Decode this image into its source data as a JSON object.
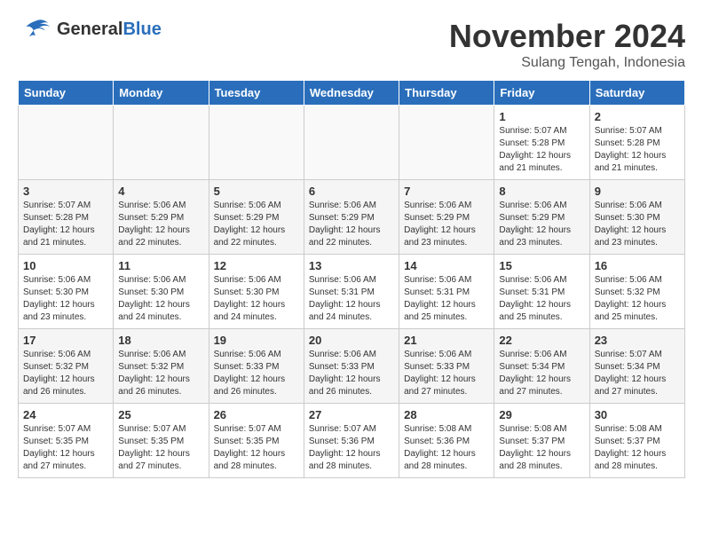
{
  "header": {
    "logo_general": "General",
    "logo_blue": "Blue",
    "month_title": "November 2024",
    "subtitle": "Sulang Tengah, Indonesia"
  },
  "weekdays": [
    "Sunday",
    "Monday",
    "Tuesday",
    "Wednesday",
    "Thursday",
    "Friday",
    "Saturday"
  ],
  "weeks": [
    [
      {
        "day": "",
        "info": ""
      },
      {
        "day": "",
        "info": ""
      },
      {
        "day": "",
        "info": ""
      },
      {
        "day": "",
        "info": ""
      },
      {
        "day": "",
        "info": ""
      },
      {
        "day": "1",
        "info": "Sunrise: 5:07 AM\nSunset: 5:28 PM\nDaylight: 12 hours\nand 21 minutes."
      },
      {
        "day": "2",
        "info": "Sunrise: 5:07 AM\nSunset: 5:28 PM\nDaylight: 12 hours\nand 21 minutes."
      }
    ],
    [
      {
        "day": "3",
        "info": "Sunrise: 5:07 AM\nSunset: 5:28 PM\nDaylight: 12 hours\nand 21 minutes."
      },
      {
        "day": "4",
        "info": "Sunrise: 5:06 AM\nSunset: 5:29 PM\nDaylight: 12 hours\nand 22 minutes."
      },
      {
        "day": "5",
        "info": "Sunrise: 5:06 AM\nSunset: 5:29 PM\nDaylight: 12 hours\nand 22 minutes."
      },
      {
        "day": "6",
        "info": "Sunrise: 5:06 AM\nSunset: 5:29 PM\nDaylight: 12 hours\nand 22 minutes."
      },
      {
        "day": "7",
        "info": "Sunrise: 5:06 AM\nSunset: 5:29 PM\nDaylight: 12 hours\nand 23 minutes."
      },
      {
        "day": "8",
        "info": "Sunrise: 5:06 AM\nSunset: 5:29 PM\nDaylight: 12 hours\nand 23 minutes."
      },
      {
        "day": "9",
        "info": "Sunrise: 5:06 AM\nSunset: 5:30 PM\nDaylight: 12 hours\nand 23 minutes."
      }
    ],
    [
      {
        "day": "10",
        "info": "Sunrise: 5:06 AM\nSunset: 5:30 PM\nDaylight: 12 hours\nand 23 minutes."
      },
      {
        "day": "11",
        "info": "Sunrise: 5:06 AM\nSunset: 5:30 PM\nDaylight: 12 hours\nand 24 minutes."
      },
      {
        "day": "12",
        "info": "Sunrise: 5:06 AM\nSunset: 5:30 PM\nDaylight: 12 hours\nand 24 minutes."
      },
      {
        "day": "13",
        "info": "Sunrise: 5:06 AM\nSunset: 5:31 PM\nDaylight: 12 hours\nand 24 minutes."
      },
      {
        "day": "14",
        "info": "Sunrise: 5:06 AM\nSunset: 5:31 PM\nDaylight: 12 hours\nand 25 minutes."
      },
      {
        "day": "15",
        "info": "Sunrise: 5:06 AM\nSunset: 5:31 PM\nDaylight: 12 hours\nand 25 minutes."
      },
      {
        "day": "16",
        "info": "Sunrise: 5:06 AM\nSunset: 5:32 PM\nDaylight: 12 hours\nand 25 minutes."
      }
    ],
    [
      {
        "day": "17",
        "info": "Sunrise: 5:06 AM\nSunset: 5:32 PM\nDaylight: 12 hours\nand 26 minutes."
      },
      {
        "day": "18",
        "info": "Sunrise: 5:06 AM\nSunset: 5:32 PM\nDaylight: 12 hours\nand 26 minutes."
      },
      {
        "day": "19",
        "info": "Sunrise: 5:06 AM\nSunset: 5:33 PM\nDaylight: 12 hours\nand 26 minutes."
      },
      {
        "day": "20",
        "info": "Sunrise: 5:06 AM\nSunset: 5:33 PM\nDaylight: 12 hours\nand 26 minutes."
      },
      {
        "day": "21",
        "info": "Sunrise: 5:06 AM\nSunset: 5:33 PM\nDaylight: 12 hours\nand 27 minutes."
      },
      {
        "day": "22",
        "info": "Sunrise: 5:06 AM\nSunset: 5:34 PM\nDaylight: 12 hours\nand 27 minutes."
      },
      {
        "day": "23",
        "info": "Sunrise: 5:07 AM\nSunset: 5:34 PM\nDaylight: 12 hours\nand 27 minutes."
      }
    ],
    [
      {
        "day": "24",
        "info": "Sunrise: 5:07 AM\nSunset: 5:35 PM\nDaylight: 12 hours\nand 27 minutes."
      },
      {
        "day": "25",
        "info": "Sunrise: 5:07 AM\nSunset: 5:35 PM\nDaylight: 12 hours\nand 27 minutes."
      },
      {
        "day": "26",
        "info": "Sunrise: 5:07 AM\nSunset: 5:35 PM\nDaylight: 12 hours\nand 28 minutes."
      },
      {
        "day": "27",
        "info": "Sunrise: 5:07 AM\nSunset: 5:36 PM\nDaylight: 12 hours\nand 28 minutes."
      },
      {
        "day": "28",
        "info": "Sunrise: 5:08 AM\nSunset: 5:36 PM\nDaylight: 12 hours\nand 28 minutes."
      },
      {
        "day": "29",
        "info": "Sunrise: 5:08 AM\nSunset: 5:37 PM\nDaylight: 12 hours\nand 28 minutes."
      },
      {
        "day": "30",
        "info": "Sunrise: 5:08 AM\nSunset: 5:37 PM\nDaylight: 12 hours\nand 28 minutes."
      }
    ]
  ]
}
